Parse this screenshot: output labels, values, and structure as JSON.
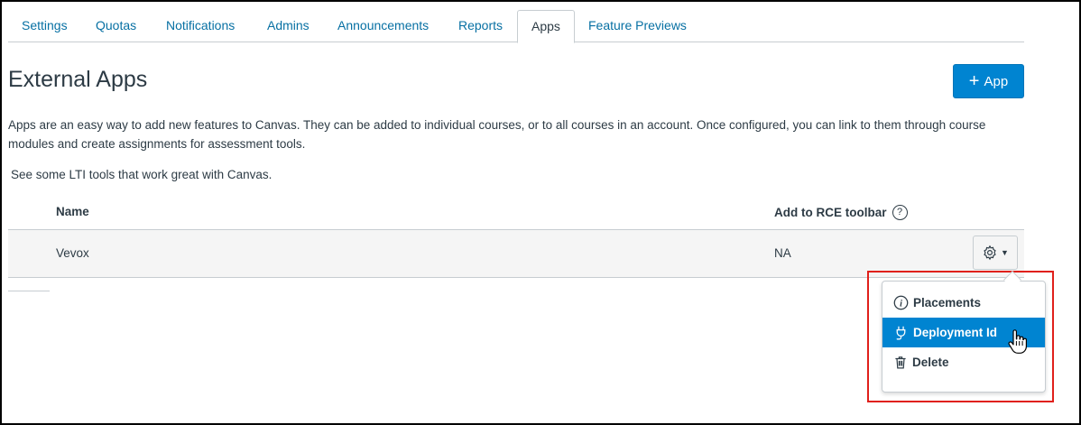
{
  "tabs": [
    {
      "label": "Settings"
    },
    {
      "label": "Quotas"
    },
    {
      "label": "Notifications"
    },
    {
      "label": "Admins"
    },
    {
      "label": "Announcements"
    },
    {
      "label": "Reports"
    },
    {
      "label": "Apps",
      "active": true
    },
    {
      "label": "Feature Previews"
    }
  ],
  "page": {
    "title": "External Apps",
    "add_button_label": "App",
    "description": "Apps are an easy way to add new features to Canvas. They can be added to individual courses, or to all courses in an account. Once configured, you can link to them through course modules and create assignments for assessment tools.",
    "lti_text": "See some LTI tools that work great with Canvas."
  },
  "table": {
    "headers": {
      "name": "Name",
      "rce": "Add to RCE toolbar"
    },
    "rows": [
      {
        "name": "Vevox",
        "rce": "NA"
      }
    ]
  },
  "menu": {
    "items": [
      {
        "label": "Placements",
        "icon": "info-icon"
      },
      {
        "label": "Deployment Id",
        "icon": "plug-icon",
        "highlighted": true
      },
      {
        "label": "Delete",
        "icon": "trash-icon"
      }
    ]
  },
  "colors": {
    "link": "#0770a3",
    "primary": "#0084d1",
    "text": "#2d3b45",
    "highlight_box": "#e0201b"
  }
}
